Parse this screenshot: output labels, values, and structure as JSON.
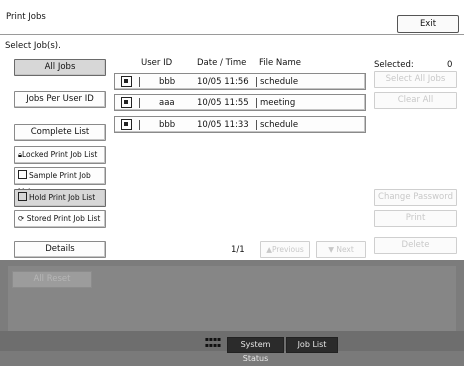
{
  "window": {
    "title": "Print Jobs",
    "exit_label": "Exit"
  },
  "select_prompt": "Select Job(s).",
  "left_buttons": {
    "all_jobs": "All Jobs",
    "jobs_per_user": "Jobs Per User ID",
    "complete_list": "Complete List",
    "locked": "Locked Print Job List",
    "sample": "Sample Print Job List",
    "hold": "Hold Print Job List",
    "stored": "Stored Print Job List",
    "details": "Details"
  },
  "table": {
    "headers": {
      "user_id": "User ID",
      "date_time": "Date / Time",
      "file_name": "File Name"
    },
    "rows": [
      {
        "user": "bbb",
        "date": "10/05 11:56",
        "file": "schedule"
      },
      {
        "user": "aaa",
        "date": "10/05 11:55",
        "file": "meeting"
      },
      {
        "user": "bbb",
        "date": "10/05 11:33",
        "file": "schedule"
      }
    ]
  },
  "right_panel": {
    "selected_label": "Selected:",
    "selected_count": "0",
    "select_all": "Select All Jobs",
    "clear_all": "Clear All",
    "change_password": "Change Password",
    "print": "Print",
    "delete": "Delete"
  },
  "pagination": {
    "page": "1/1",
    "previous": "▲Previous",
    "next": "▼ Next"
  },
  "lower_button": "All Reset",
  "status_bar": {
    "system_status": "System Status",
    "job_list": "Job List"
  }
}
